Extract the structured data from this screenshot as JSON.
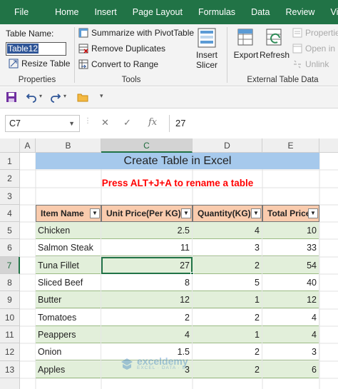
{
  "menu": [
    "File",
    "Home",
    "Insert",
    "Page Layout",
    "Formulas",
    "Data",
    "Review",
    "View"
  ],
  "ribbon": {
    "table_name_label": "Table Name:",
    "table_name_value": "Table12",
    "resize_table": "Resize Table",
    "properties_group": "Properties",
    "summarize_pivot": "Summarize with PivotTable",
    "remove_duplicates": "Remove Duplicates",
    "convert_to_range": "Convert to Range",
    "tools_group": "Tools",
    "insert_slicer_1": "Insert",
    "insert_slicer_2": "Slicer",
    "export": "Export",
    "refresh": "Refresh",
    "properties_btn": "Properties",
    "open_in_browser": "Open in B",
    "unlink": "Unlink",
    "external_group": "External Table Data"
  },
  "formula_bar": {
    "name_box": "C7",
    "fx": "fx",
    "cancel": "✕",
    "enter": "✓",
    "value": "27"
  },
  "columns": [
    "A",
    "B",
    "C",
    "D",
    "E"
  ],
  "rows": [
    "1",
    "2",
    "3",
    "4",
    "5",
    "6",
    "7",
    "8",
    "9",
    "10",
    "11",
    "12",
    "13"
  ],
  "sheet": {
    "title": "Create Table in Excel",
    "note": "Press ALT+J+A to rename a table",
    "headers": [
      "Item Name",
      "Unit Price(Per KG)",
      "Quantity(KG)",
      "Total Price"
    ],
    "data": [
      {
        "item": "Chicken",
        "price": "2.5",
        "qty": "4",
        "total": "10"
      },
      {
        "item": "Salmon Steak",
        "price": "11",
        "qty": "3",
        "total": "33"
      },
      {
        "item": "Tuna Fillet",
        "price": "27",
        "qty": "2",
        "total": "54"
      },
      {
        "item": "Sliced Beef",
        "price": "8",
        "qty": "5",
        "total": "40"
      },
      {
        "item": "Butter",
        "price": "12",
        "qty": "1",
        "total": "12"
      },
      {
        "item": "Tomatoes",
        "price": "2",
        "qty": "2",
        "total": "4"
      },
      {
        "item": "Peappers",
        "price": "4",
        "qty": "1",
        "total": "4"
      },
      {
        "item": "Onion",
        "price": "1.5",
        "qty": "2",
        "total": "3"
      },
      {
        "item": "Apples",
        "price": "3",
        "qty": "2",
        "total": "6"
      }
    ]
  },
  "watermark": {
    "name": "exceldemy",
    "tagline": "EXCEL · DATA · BI"
  },
  "colors": {
    "accent": "#217346",
    "table_header": "#F9CBAD",
    "band": "#E2EFDA",
    "title_band": "#A6C9EC",
    "note": "#FF0000"
  }
}
